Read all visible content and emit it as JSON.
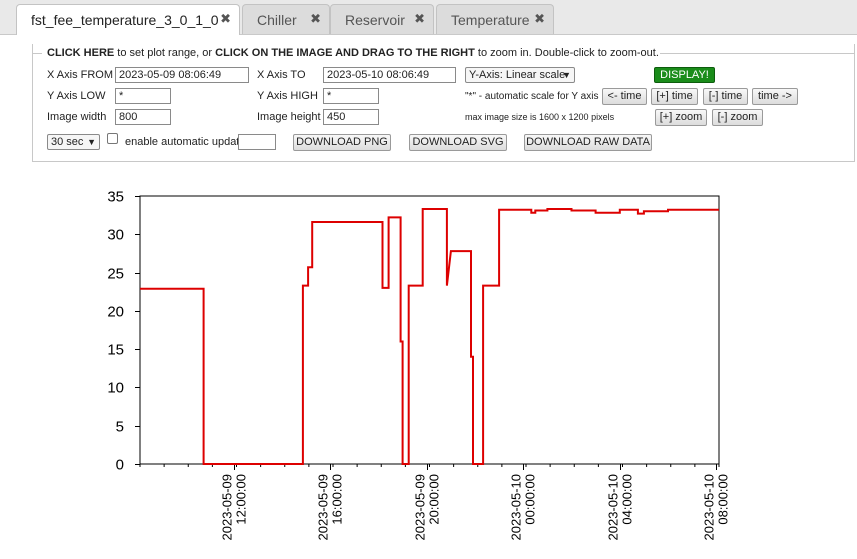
{
  "tabs": [
    {
      "label": "fst_fee_temperature_3_0_1_0",
      "active": true
    },
    {
      "label": "Chiller",
      "active": false
    },
    {
      "label": "Reservoir",
      "active": false
    },
    {
      "label": "Temperature",
      "active": false
    }
  ],
  "close_glyph": "✖",
  "controls": {
    "legend_part1": "CLICK HERE",
    "legend_part2": " to set plot range, or ",
    "legend_part3": "CLICK ON THE IMAGE AND DRAG TO THE RIGHT",
    "legend_part4": " to zoom in. Double-click to zoom-out.",
    "x_from_label": "X Axis FROM",
    "x_from_value": "2023-05-09 08:06:49",
    "x_to_label": "X Axis TO",
    "x_to_value": "2023-05-10 08:06:49",
    "y_axis_scale": "Y-Axis: Linear scale",
    "display_button": "DISPLAY!",
    "y_low_label": "Y Axis LOW",
    "y_low_value": "*",
    "y_high_label": "Y Axis HIGH",
    "y_high_value": "*",
    "auto_scale_note": "\"*\" - automatic scale for Y axis",
    "time_back": "<- time",
    "time_plus": "[+] time",
    "time_minus": "[-] time",
    "time_forward": "time ->",
    "width_label": "Image width",
    "width_value": "800",
    "height_label": "Image height",
    "height_value": "450",
    "max_size_note": "max image size is 1600 x 1200 pixels",
    "zoom_plus": "[+] zoom",
    "zoom_minus": "[-] zoom",
    "refresh_interval": "30 sec",
    "auto_update_label": "enable automatic update",
    "auto_update_checked": false,
    "auto_update_value": "",
    "download_png": "DOWNLOAD PNG",
    "download_svg": "DOWNLOAD SVG",
    "download_raw": "DOWNLOAD RAW DATA"
  },
  "chart_data": {
    "type": "line",
    "title": "",
    "xlabel": "",
    "ylabel": "",
    "ylim": [
      0,
      35
    ],
    "xlim": [
      "2023-05-09 08:06:49",
      "2023-05-10 08:06:49"
    ],
    "yticks": [
      0,
      5,
      10,
      15,
      20,
      25,
      30,
      35
    ],
    "xticks": [
      {
        "date": "2023-05-09",
        "time": "12:00:00"
      },
      {
        "date": "2023-05-09",
        "time": "16:00:00"
      },
      {
        "date": "2023-05-09",
        "time": "20:00:00"
      },
      {
        "date": "2023-05-10",
        "time": "00:00:00"
      },
      {
        "date": "2023-05-10",
        "time": "04:00:00"
      },
      {
        "date": "2023-05-10",
        "time": "08:00:00"
      }
    ],
    "grid": true,
    "line_color": "#dd0000",
    "series": [
      {
        "values": [
          {
            "t": "2023-05-09 08:06:49",
            "y": 22.9
          },
          {
            "t": "2023-05-09 10:45",
            "y": 22.9
          },
          {
            "t": "2023-05-09 10:45",
            "y": 0
          },
          {
            "t": "2023-05-09 14:52",
            "y": 0
          },
          {
            "t": "2023-05-09 14:52",
            "y": 23.3
          },
          {
            "t": "2023-05-09 15:05",
            "y": 23.3
          },
          {
            "t": "2023-05-09 15:05",
            "y": 25.7
          },
          {
            "t": "2023-05-09 15:15",
            "y": 25.7
          },
          {
            "t": "2023-05-09 15:15",
            "y": 31.6
          },
          {
            "t": "2023-05-09 18:10",
            "y": 31.6
          },
          {
            "t": "2023-05-09 18:10",
            "y": 23.0
          },
          {
            "t": "2023-05-09 18:25",
            "y": 23.0
          },
          {
            "t": "2023-05-09 18:25",
            "y": 32.2
          },
          {
            "t": "2023-05-09 18:55",
            "y": 32.2
          },
          {
            "t": "2023-05-09 18:55",
            "y": 16.0
          },
          {
            "t": "2023-05-09 19:00",
            "y": 16.0
          },
          {
            "t": "2023-05-09 19:00",
            "y": 0
          },
          {
            "t": "2023-05-09 19:15",
            "y": 0
          },
          {
            "t": "2023-05-09 19:15",
            "y": 23.3
          },
          {
            "t": "2023-05-09 19:50",
            "y": 23.3
          },
          {
            "t": "2023-05-09 19:50",
            "y": 33.3
          },
          {
            "t": "2023-05-09 20:50",
            "y": 33.3
          },
          {
            "t": "2023-05-09 20:50",
            "y": 23.3
          },
          {
            "t": "2023-05-09 21:00",
            "y": 27.8
          },
          {
            "t": "2023-05-09 21:50",
            "y": 27.8
          },
          {
            "t": "2023-05-09 21:50",
            "y": 14.0
          },
          {
            "t": "2023-05-09 21:55",
            "y": 14.0
          },
          {
            "t": "2023-05-09 21:55",
            "y": 0
          },
          {
            "t": "2023-05-09 22:20",
            "y": 0
          },
          {
            "t": "2023-05-09 22:20",
            "y": 23.3
          },
          {
            "t": "2023-05-09 23:00",
            "y": 23.3
          },
          {
            "t": "2023-05-09 23:00",
            "y": 33.2
          },
          {
            "t": "2023-05-10 00:20",
            "y": 33.2
          },
          {
            "t": "2023-05-10 00:20",
            "y": 32.8
          },
          {
            "t": "2023-05-10 00:30",
            "y": 32.8
          },
          {
            "t": "2023-05-10 00:30",
            "y": 33.1
          },
          {
            "t": "2023-05-10 01:00",
            "y": 33.1
          },
          {
            "t": "2023-05-10 01:00",
            "y": 33.3
          },
          {
            "t": "2023-05-10 02:00",
            "y": 33.3
          },
          {
            "t": "2023-05-10 02:00",
            "y": 33.1
          },
          {
            "t": "2023-05-10 03:00",
            "y": 33.1
          },
          {
            "t": "2023-05-10 03:00",
            "y": 32.8
          },
          {
            "t": "2023-05-10 04:00",
            "y": 32.8
          },
          {
            "t": "2023-05-10 04:00",
            "y": 33.2
          },
          {
            "t": "2023-05-10 04:45",
            "y": 33.2
          },
          {
            "t": "2023-05-10 04:45",
            "y": 32.7
          },
          {
            "t": "2023-05-10 05:00",
            "y": 32.7
          },
          {
            "t": "2023-05-10 05:00",
            "y": 33.0
          },
          {
            "t": "2023-05-10 06:00",
            "y": 33.0
          },
          {
            "t": "2023-05-10 06:00",
            "y": 33.2
          },
          {
            "t": "2023-05-10 08:06:49",
            "y": 33.2
          }
        ]
      }
    ]
  }
}
